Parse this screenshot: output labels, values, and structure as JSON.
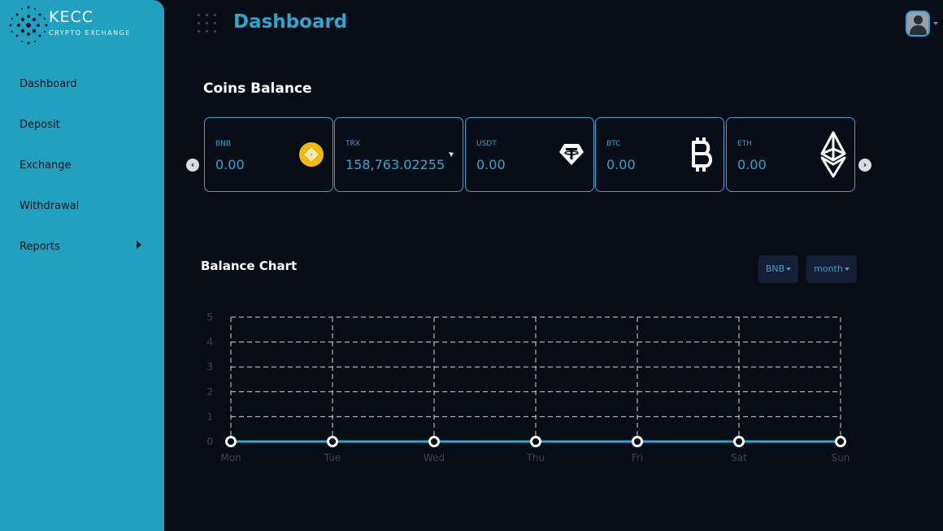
{
  "brand": {
    "name": "KECC",
    "subtitle": "CRYPTO EXCHANGE"
  },
  "sidebar": {
    "items": [
      {
        "label": "Dashboard"
      },
      {
        "label": "Deposit"
      },
      {
        "label": "Exchange"
      },
      {
        "label": "Withdrawal"
      },
      {
        "label": "Reports"
      }
    ]
  },
  "header": {
    "title": "Dashboard"
  },
  "coins": {
    "title": "Coins Balance",
    "cards": [
      {
        "name": "BNB",
        "balance": "0.00",
        "icon": "bnb-icon"
      },
      {
        "name": "TRX",
        "balance": "158,763.02255",
        "icon": "trx-icon"
      },
      {
        "name": "USDT",
        "balance": "0.00",
        "icon": "usdt-icon"
      },
      {
        "name": "BTC",
        "balance": "0.00",
        "icon": "btc-icon"
      },
      {
        "name": "ETH",
        "balance": "0.00",
        "icon": "eth-icon"
      }
    ]
  },
  "balance_chart": {
    "title": "Balance Chart",
    "coin_select": "BNB",
    "period_select": "month"
  },
  "chart_data": {
    "type": "line",
    "categories": [
      "Mon",
      "Tue",
      "Wed",
      "Thu",
      "Fri",
      "Sat",
      "Sun"
    ],
    "series": [
      {
        "values": [
          0,
          0,
          0,
          0,
          0,
          0,
          0
        ]
      }
    ],
    "yticks": [
      "0",
      "1",
      "2",
      "3",
      "4",
      "5"
    ],
    "ylim": [
      0,
      5
    ],
    "grid": true,
    "colors": {
      "line": "#2ca8cf",
      "grid": "#cfd6dc"
    }
  }
}
